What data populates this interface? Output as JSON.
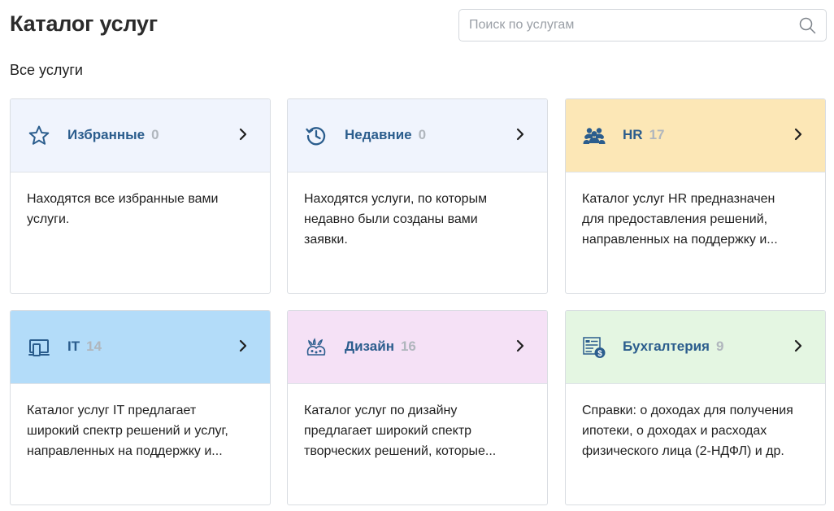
{
  "header": {
    "title": "Каталог услуг",
    "search_placeholder": "Поиск по услугам"
  },
  "section": {
    "title": "Все услуги"
  },
  "cards": [
    {
      "title": "Избранные",
      "count": "0",
      "icon": "star-icon",
      "head_color": "#f0f4fd",
      "description": "Находятся все избранные вами услуги."
    },
    {
      "title": "Недавние",
      "count": "0",
      "icon": "history-icon",
      "head_color": "#f0f4fd",
      "description": "Находятся услуги, по которым недавно были созданы вами заявки."
    },
    {
      "title": "HR",
      "count": "17",
      "icon": "people-icon",
      "head_color": "#fce7b6",
      "description": "Каталог услуг HR предназначен для предоставления решений, направленных на поддержку и..."
    },
    {
      "title": "IT",
      "count": "14",
      "icon": "devices-icon",
      "head_color": "#b3dcf9",
      "description": "Каталог услуг IT предлагает широкий спектр решений и услуг, направленных на поддержку и..."
    },
    {
      "title": "Дизайн",
      "count": "16",
      "icon": "palette-icon",
      "head_color": "#f5e1f6",
      "description": "Каталог услуг по дизайну предлагает широкий спектр творческих решений, которые..."
    },
    {
      "title": "Бухгалтерия",
      "count": "9",
      "icon": "accounting-icon",
      "head_color": "#e4f6e2",
      "description": "Справки: о доходах для получения ипотеки, о доходах и расходах физического лица (2-НДФЛ) и др."
    }
  ]
}
